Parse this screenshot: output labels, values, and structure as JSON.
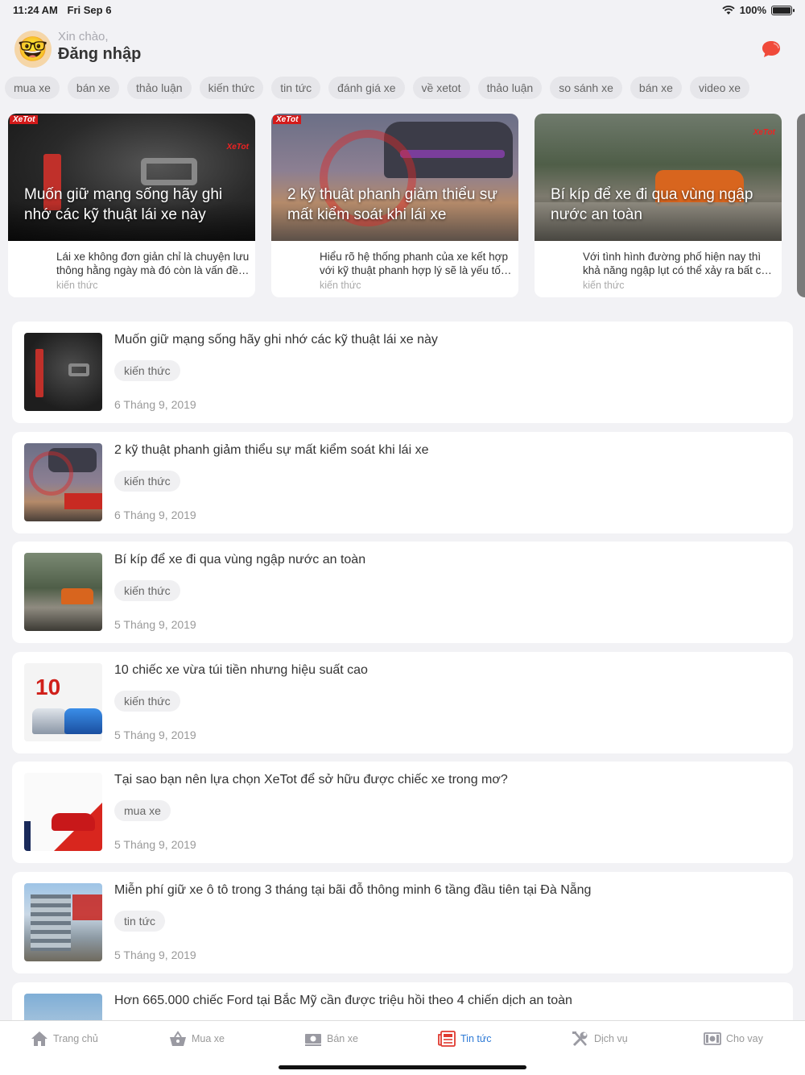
{
  "status": {
    "time": "11:24 AM",
    "date": "Fri Sep 6",
    "battery": "100%"
  },
  "header": {
    "greeting": "Xin chào,",
    "login": "Đăng nhập"
  },
  "chips": [
    "mua xe",
    "bán xe",
    "thảo luận",
    "kiến thức",
    "tin tức",
    "đánh giá xe",
    "về xetot",
    "thảo luận",
    "so sánh xe",
    "bán xe",
    "video xe"
  ],
  "featured": [
    {
      "title": "Muốn giữ mạng sống hãy ghi nhớ các kỹ thuật lái xe này",
      "desc": "Lái xe không đơn giản chỉ là chuyện lưu thông hằng ngày mà đó còn là vấn đề an toàn",
      "category": "kiến thức",
      "brand": "XeTot"
    },
    {
      "title": "2 kỹ thuật phanh giảm thiểu sự mất kiểm soát khi lái xe",
      "desc": "Hiểu rõ hệ thống phanh của xe kết hợp với kỹ thuật phanh hợp lý sẽ là yếu tố quan trọng",
      "category": "kiến thức",
      "brand": "XeTot"
    },
    {
      "title": "Bí kíp để xe đi qua vùng ngập nước an toàn",
      "desc": "Với tình hình đường phố hiện nay thì khả năng ngập lụt có thể xảy ra bất cứ lúc nào",
      "category": "kiến thức",
      "brand": "XeTot"
    }
  ],
  "articles": [
    {
      "title": "Muốn giữ mạng sống hãy ghi nhớ các kỹ thuật lái xe này",
      "category": "kiến thức",
      "date": "6 Tháng 9, 2019"
    },
    {
      "title": "2 kỹ thuật phanh giảm thiểu sự mất kiểm soát khi lái xe",
      "category": "kiến thức",
      "date": "6 Tháng 9, 2019"
    },
    {
      "title": "Bí kíp để xe đi qua vùng ngập nước an toàn",
      "category": "kiến thức",
      "date": "5 Tháng 9, 2019"
    },
    {
      "title": "10 chiếc xe vừa túi tiền nhưng hiệu suất cao",
      "category": "kiến thức",
      "date": "5 Tháng 9, 2019"
    },
    {
      "title": "Tại sao bạn nên lựa chọn XeTot để sở hữu được chiếc xe trong mơ?",
      "category": "mua xe",
      "date": "5 Tháng 9, 2019"
    },
    {
      "title": "Miễn phí giữ xe ô tô trong 3 tháng tại bãi đỗ thông minh 6 tầng đầu tiên tại Đà Nẵng",
      "category": "tin tức",
      "date": "5 Tháng 9, 2019"
    },
    {
      "title": "Hơn 665.000 chiếc Ford tại Bắc Mỹ cần được triệu hồi theo 4 chiến dịch an toàn",
      "category": "",
      "date": ""
    }
  ],
  "tabs": [
    {
      "label": "Trang chủ",
      "icon": "home-icon"
    },
    {
      "label": "Mua xe",
      "icon": "basket-icon"
    },
    {
      "label": "Bán xe",
      "icon": "cash-icon"
    },
    {
      "label": "Tin tức",
      "icon": "news-icon"
    },
    {
      "label": "Dịch vụ",
      "icon": "tools-icon"
    },
    {
      "label": "Cho vay",
      "icon": "money-icon"
    }
  ],
  "colors": {
    "accent": "#2d7ad6",
    "brand": "#d31a1a",
    "chat": "#f04a3a"
  }
}
